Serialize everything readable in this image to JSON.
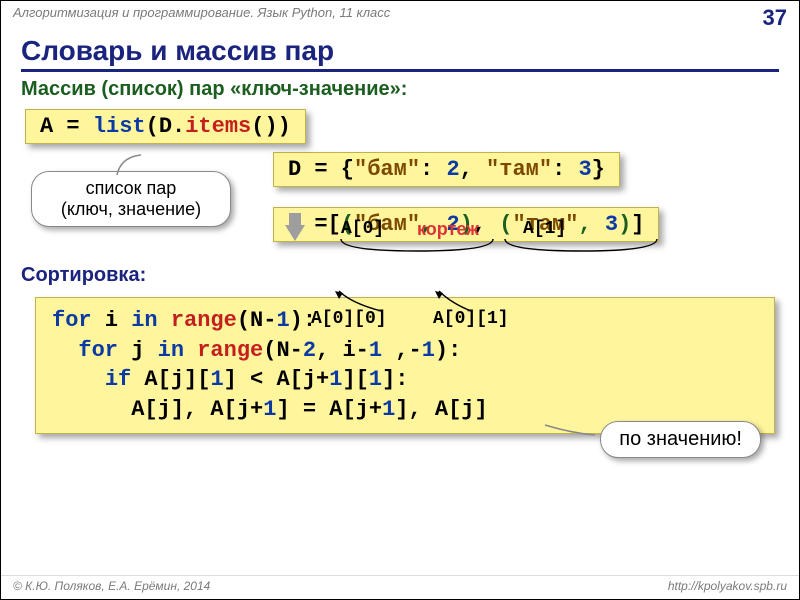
{
  "header": {
    "subject": "Алгоритмизация и программирование. Язык Python, 11 класс",
    "page": "37"
  },
  "title": "Словарь и массив пар",
  "section1": "Массив (список) пар «ключ-значение»:",
  "code1": {
    "A": "A = ",
    "list": "list",
    "paren1": "(",
    "D": "D",
    "dot": ".",
    "items": "items",
    "paren2": "())"
  },
  "bubble1": {
    "l1": "список пар",
    "l2": "(ключ, значение)"
  },
  "codeD": {
    "pre": "D = {",
    "s1": "\"бам\"",
    "c1": ": ",
    "n1": "2",
    "c2": ", ",
    "s2": "\"там\"",
    "c3": ": ",
    "n2": "3",
    "post": "}"
  },
  "labels": {
    "a0": "A[0]",
    "a1": "A[1]",
    "tuple": "кортеж",
    "a00": "A[0][0]",
    "a01": "A[0][1]"
  },
  "codeA": {
    "pre": "A =[",
    "p1a": "(",
    "s1": "\"бам\"",
    "c1": ", ",
    "n1": "2",
    "p1b": ")",
    "c2": ", ",
    "p2a": "(",
    "s2": "\"там\"",
    "c3": ", ",
    "n2": "3",
    "p2b": ")",
    "post": "]"
  },
  "section2": "Сортировка:",
  "code2": {
    "l1": {
      "for": "for",
      "sp1": " i ",
      "in": "in",
      "sp2": " ",
      "range": "range",
      "p1": "(N-",
      "n1": "1",
      "p2": "):"
    },
    "l2": {
      "pad": "  ",
      "for": "for",
      "sp1": " j ",
      "in": "in",
      "sp2": " ",
      "range": "range",
      "p1": "(N-",
      "n2": "2",
      "c1": ", i-",
      "n1": "1",
      "c2": " ,-",
      "nm1": "1",
      "p2": "):"
    },
    "l3": {
      "pad": "    ",
      "if": "if",
      "t": " A[j][",
      "n1": "1",
      "t2": "] < A[j+",
      "n2": "1",
      "t3": "][",
      "n3": "1",
      "t4": "]:"
    },
    "l4": {
      "pad": "      ",
      "t": "A[j], A[j+",
      "n1": "1",
      "t2": "] = A[j+",
      "n2": "1",
      "t3": "], A[j]"
    }
  },
  "bubble2": "по значению!",
  "footer": {
    "left": "© К.Ю. Поляков, Е.А. Ерёмин, 2014",
    "right": "http://kpolyakov.spb.ru"
  }
}
